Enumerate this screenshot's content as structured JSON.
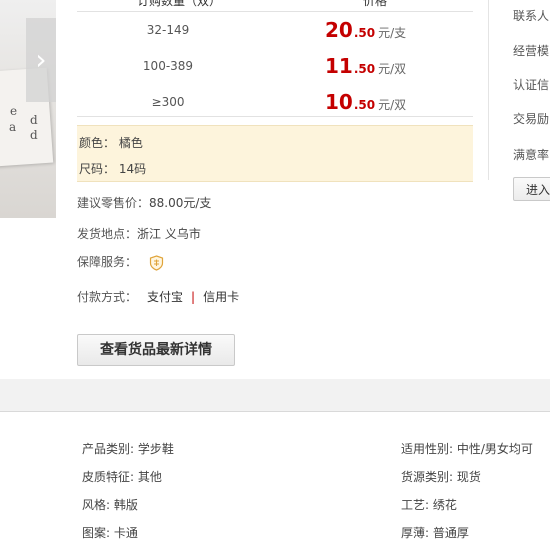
{
  "price_table": {
    "header_left": "订购数量（双）",
    "header_right": "价格",
    "rows": [
      {
        "qty": "32-149",
        "price_int": "20",
        "price_dec": ".50",
        "unit": "元/支"
      },
      {
        "qty": "100-389",
        "price_int": "11",
        "price_dec": ".50",
        "unit": "元/双"
      },
      {
        "qty": "≥300",
        "price_int": "10",
        "price_dec": ".50",
        "unit": "元/双"
      }
    ]
  },
  "spec": {
    "color": "颜色：  橘色",
    "size": "尺码：  14码"
  },
  "retail": {
    "label": "建议零售价：",
    "value": "88.00元/支"
  },
  "ship": {
    "label": "发货地点：",
    "value": "浙江 义乌市"
  },
  "guarantee": {
    "label": "保障服务：",
    "icon": "shield-guarantee-icon"
  },
  "payment": {
    "label": "付款方式：",
    "method1": "支付宝",
    "separator": "|",
    "method2": "信用卡"
  },
  "detail_button": "查看货品最新详情",
  "sidebar": {
    "items": [
      "联系人",
      "经营模",
      "认证信",
      "交易励",
      "满意率"
    ],
    "enter_button": "进入"
  },
  "attributes": [
    {
      "text": "产品类别: 学步鞋"
    },
    {
      "text": "适用性别: 中性/男女均可"
    },
    {
      "text": "皮质特征: 其他"
    },
    {
      "text": "货源类别: 现货"
    },
    {
      "text": "风格: 韩版"
    },
    {
      "text": "工艺: 绣花"
    },
    {
      "text": "图案: 卡通"
    },
    {
      "text": "厚薄: 普通厚"
    }
  ],
  "colors": {
    "price_red": "#c40000",
    "spec_bg": "#fdf4dc"
  }
}
